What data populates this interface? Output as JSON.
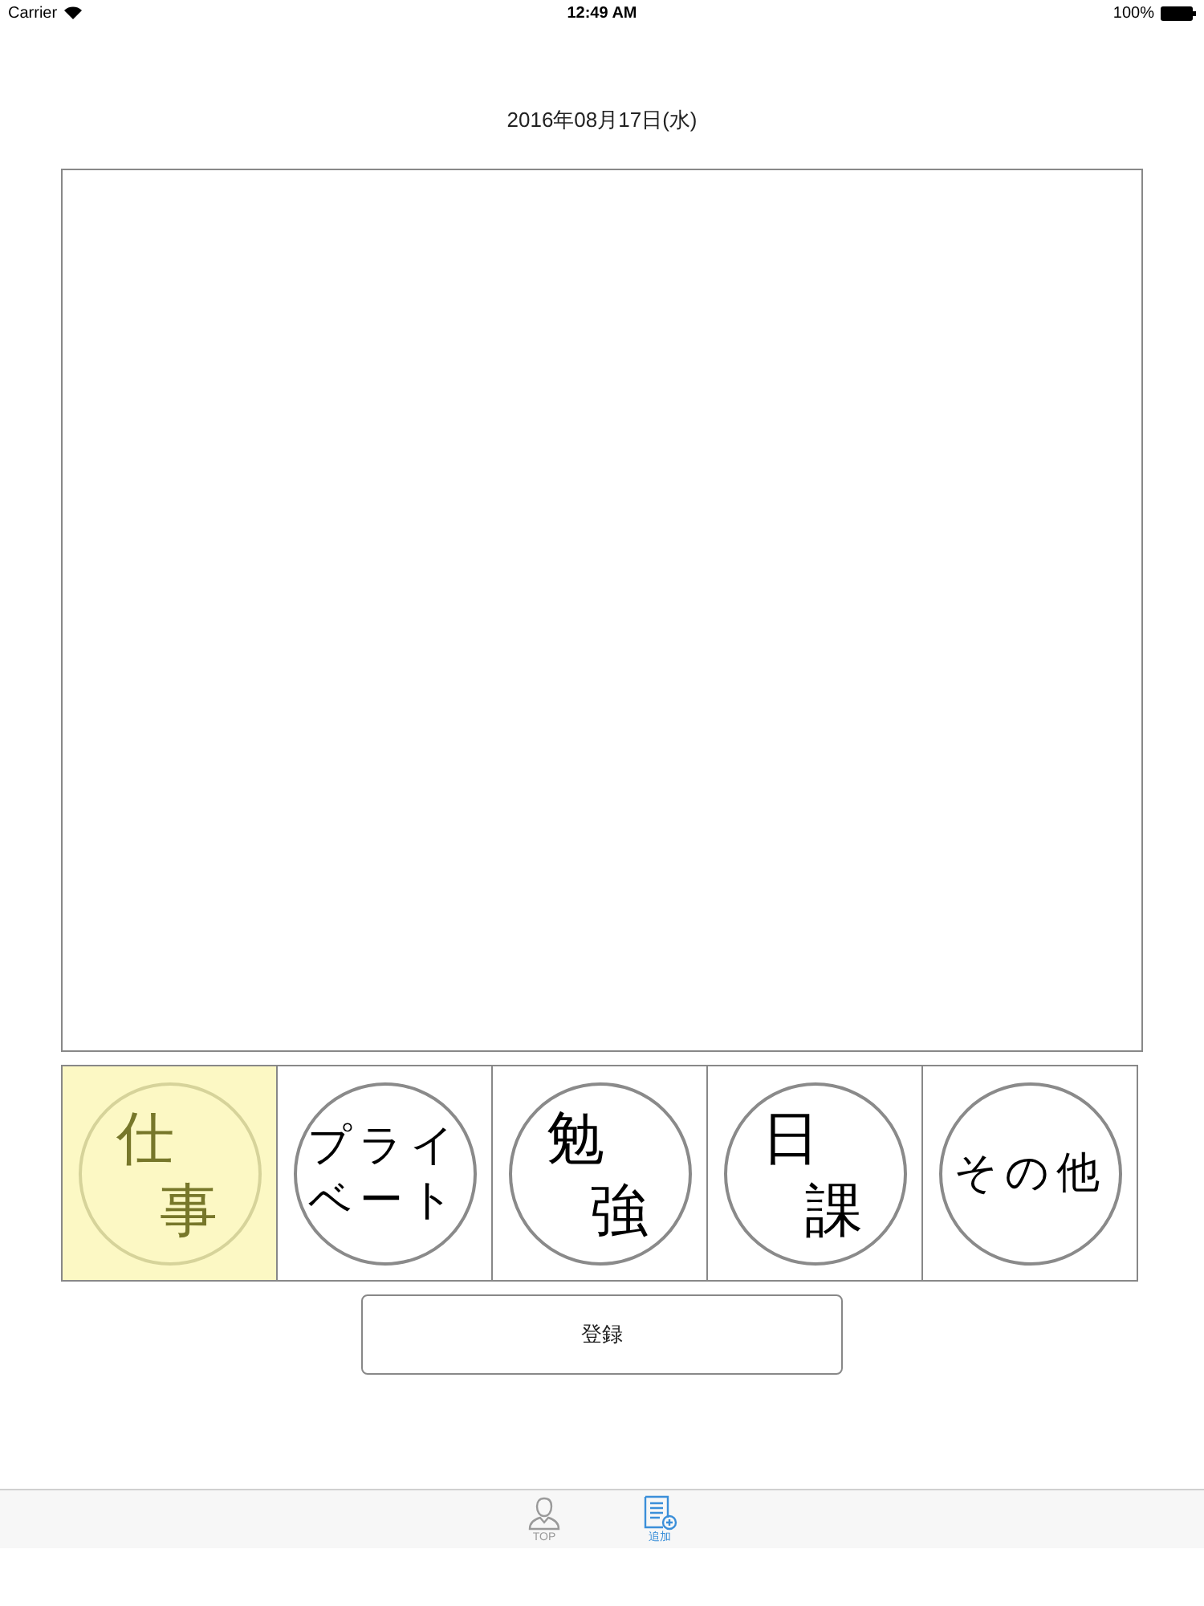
{
  "status_bar": {
    "carrier": "Carrier",
    "time": "12:49 AM",
    "battery": "100%"
  },
  "date": "2016年08月17日(水)",
  "categories": [
    {
      "lines": [
        "仕",
        "事"
      ],
      "selected": true
    },
    {
      "lines": [
        "プライ",
        "ベート"
      ],
      "selected": false
    },
    {
      "lines": [
        "勉",
        "強"
      ],
      "selected": false
    },
    {
      "lines": [
        "日",
        "課"
      ],
      "selected": false
    },
    {
      "lines": [
        "その他"
      ],
      "selected": false
    }
  ],
  "register_button": "登録",
  "tabs": [
    {
      "label": "TOP",
      "kind": "person",
      "selected": false
    },
    {
      "label": "追加",
      "kind": "add",
      "selected": true
    }
  ]
}
